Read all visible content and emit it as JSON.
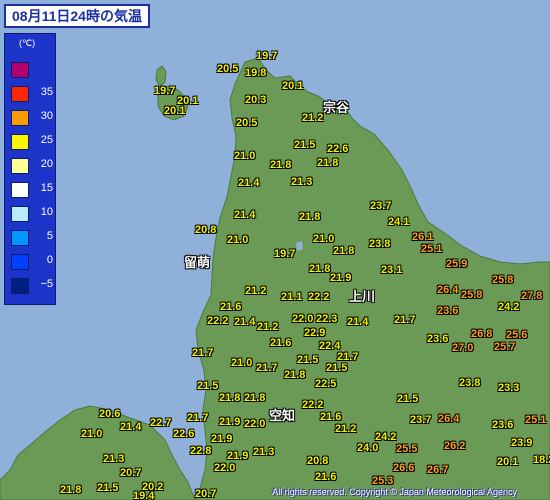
{
  "title": "08月11日24時の気温",
  "legend": {
    "unit": "(℃)",
    "levels": [
      {
        "label": "",
        "color": "#b4006e"
      },
      {
        "label": "35",
        "color": "#ff2800"
      },
      {
        "label": "30",
        "color": "#ff9900"
      },
      {
        "label": "25",
        "color": "#faf500"
      },
      {
        "label": "20",
        "color": "#ffff96"
      },
      {
        "label": "15",
        "color": "#ffffff"
      },
      {
        "label": "10",
        "color": "#b9ebff"
      },
      {
        "label": "5",
        "color": "#0096ff"
      },
      {
        "label": "0",
        "color": "#0041ff"
      },
      {
        "label": "−5",
        "color": "#002080"
      }
    ]
  },
  "places": [
    "宗谷",
    "留萌",
    "上川",
    "空知"
  ],
  "temperatures": [
    {
      "value": "19.7",
      "hot": false
    },
    {
      "value": "20.5",
      "hot": false
    },
    {
      "value": "19.8",
      "hot": false
    },
    {
      "value": "19.7",
      "hot": false
    },
    {
      "value": "20.1",
      "hot": false
    },
    {
      "value": "20.1",
      "hot": false
    },
    {
      "value": "20.3",
      "hot": false
    },
    {
      "value": "20.1",
      "hot": false
    },
    {
      "value": "21.2",
      "hot": false
    },
    {
      "value": "20.5",
      "hot": false
    },
    {
      "value": "21.5",
      "hot": false
    },
    {
      "value": "22.6",
      "hot": false
    },
    {
      "value": "21.0",
      "hot": false
    },
    {
      "value": "21.8",
      "hot": false
    },
    {
      "value": "21.8",
      "hot": false
    },
    {
      "value": "21.4",
      "hot": false
    },
    {
      "value": "21.3",
      "hot": false
    },
    {
      "value": "23.7",
      "hot": false
    },
    {
      "value": "21.4",
      "hot": false
    },
    {
      "value": "21.8",
      "hot": false
    },
    {
      "value": "24.1",
      "hot": false
    },
    {
      "value": "20.8",
      "hot": false
    },
    {
      "value": "21.0",
      "hot": false
    },
    {
      "value": "21.0",
      "hot": false
    },
    {
      "value": "26.1",
      "hot": true
    },
    {
      "value": "23.8",
      "hot": false
    },
    {
      "value": "21.8",
      "hot": false
    },
    {
      "value": "25.1",
      "hot": true
    },
    {
      "value": "19.7",
      "hot": false
    },
    {
      "value": "21.8",
      "hot": false
    },
    {
      "value": "25.9",
      "hot": true
    },
    {
      "value": "23.1",
      "hot": false
    },
    {
      "value": "21.9",
      "hot": false
    },
    {
      "value": "25.8",
      "hot": true
    },
    {
      "value": "21.2",
      "hot": false
    },
    {
      "value": "26.4",
      "hot": true
    },
    {
      "value": "25.8",
      "hot": true
    },
    {
      "value": "27.8",
      "hot": true
    },
    {
      "value": "21.1",
      "hot": false
    },
    {
      "value": "22.2",
      "hot": false
    },
    {
      "value": "24.2",
      "hot": false
    },
    {
      "value": "21.6",
      "hot": false
    },
    {
      "value": "23.6",
      "hot": true
    },
    {
      "value": "22.2",
      "hot": false
    },
    {
      "value": "21.4",
      "hot": false
    },
    {
      "value": "22.0",
      "hot": false
    },
    {
      "value": "22.3",
      "hot": false
    },
    {
      "value": "21.4",
      "hot": false
    },
    {
      "value": "21.7",
      "hot": false
    },
    {
      "value": "21.2",
      "hot": false
    },
    {
      "value": "22.9",
      "hot": false
    },
    {
      "value": "23.6",
      "hot": false
    },
    {
      "value": "26.8",
      "hot": true
    },
    {
      "value": "25.6",
      "hot": true
    },
    {
      "value": "21.6",
      "hot": false
    },
    {
      "value": "27.0",
      "hot": true
    },
    {
      "value": "25.7",
      "hot": true
    },
    {
      "value": "22.4",
      "hot": false
    },
    {
      "value": "21.7",
      "hot": false
    },
    {
      "value": "21.7",
      "hot": false
    },
    {
      "value": "21.0",
      "hot": false
    },
    {
      "value": "21.5",
      "hot": false
    },
    {
      "value": "21.5",
      "hot": false
    },
    {
      "value": "21.7",
      "hot": false
    },
    {
      "value": "21.8",
      "hot": false
    },
    {
      "value": "22.5",
      "hot": false
    },
    {
      "value": "23.8",
      "hot": false
    },
    {
      "value": "21.5",
      "hot": false
    },
    {
      "value": "23.3",
      "hot": false
    },
    {
      "value": "21.8",
      "hot": false
    },
    {
      "value": "21.8",
      "hot": false
    },
    {
      "value": "21.5",
      "hot": false
    },
    {
      "value": "22.2",
      "hot": false
    },
    {
      "value": "20.6",
      "hot": false
    },
    {
      "value": "21.7",
      "hot": false
    },
    {
      "value": "21.6",
      "hot": false
    },
    {
      "value": "23.7",
      "hot": false
    },
    {
      "value": "26.4",
      "hot": true
    },
    {
      "value": "23.6",
      "hot": false
    },
    {
      "value": "25.1",
      "hot": true
    },
    {
      "value": "21.4",
      "hot": false
    },
    {
      "value": "22.7",
      "hot": false
    },
    {
      "value": "21.9",
      "hot": false
    },
    {
      "value": "22.0",
      "hot": false
    },
    {
      "value": "21.0",
      "hot": false
    },
    {
      "value": "22.6",
      "hot": false
    },
    {
      "value": "21.2",
      "hot": false
    },
    {
      "value": "24.2",
      "hot": false
    },
    {
      "value": "21.9",
      "hot": false
    },
    {
      "value": "25.5",
      "hot": true
    },
    {
      "value": "23.9",
      "hot": false
    },
    {
      "value": "21.3",
      "hot": false
    },
    {
      "value": "22.8",
      "hot": false
    },
    {
      "value": "24.0",
      "hot": false
    },
    {
      "value": "26.2",
      "hot": true
    },
    {
      "value": "21.9",
      "hot": false
    },
    {
      "value": "21.3",
      "hot": false
    },
    {
      "value": "20.8",
      "hot": false
    },
    {
      "value": "20.1",
      "hot": false
    },
    {
      "value": "18.2",
      "hot": false
    },
    {
      "value": "22.0",
      "hot": false
    },
    {
      "value": "26.6",
      "hot": true
    },
    {
      "value": "26.7",
      "hot": true
    },
    {
      "value": "20.7",
      "hot": false
    },
    {
      "value": "21.6",
      "hot": false
    },
    {
      "value": "25.3",
      "hot": true
    },
    {
      "value": "21.8",
      "hot": false
    },
    {
      "value": "21.5",
      "hot": false
    },
    {
      "value": "20.2",
      "hot": false
    },
    {
      "value": "19.4",
      "hot": false
    },
    {
      "value": "20.7",
      "hot": false
    }
  ],
  "copyright": "All rights reserved. Copyright © Japan Meteorological Agency"
}
